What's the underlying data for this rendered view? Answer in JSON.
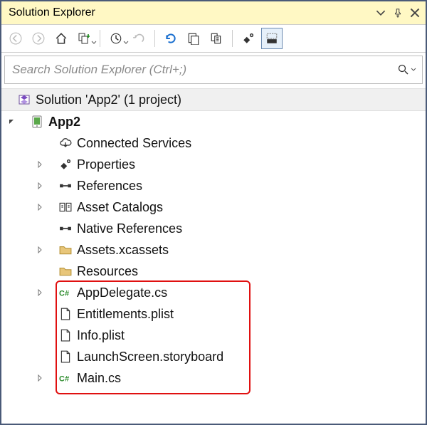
{
  "title": "Solution Explorer",
  "search": {
    "placeholder": "Search Solution Explorer (Ctrl+;)"
  },
  "solution": {
    "label": "Solution 'App2' (1 project)"
  },
  "project": {
    "label": "App2"
  },
  "nodes": {
    "connected": "Connected Services",
    "properties": "Properties",
    "references": "References",
    "assetcatalogs": "Asset Catalogs",
    "nativerefs": "Native References",
    "assetsx": "Assets.xcassets",
    "resources": "Resources",
    "appdelegate": "AppDelegate.cs",
    "entitlements": "Entitlements.plist",
    "info": "Info.plist",
    "launch": "LaunchScreen.storyboard",
    "main": "Main.cs"
  }
}
